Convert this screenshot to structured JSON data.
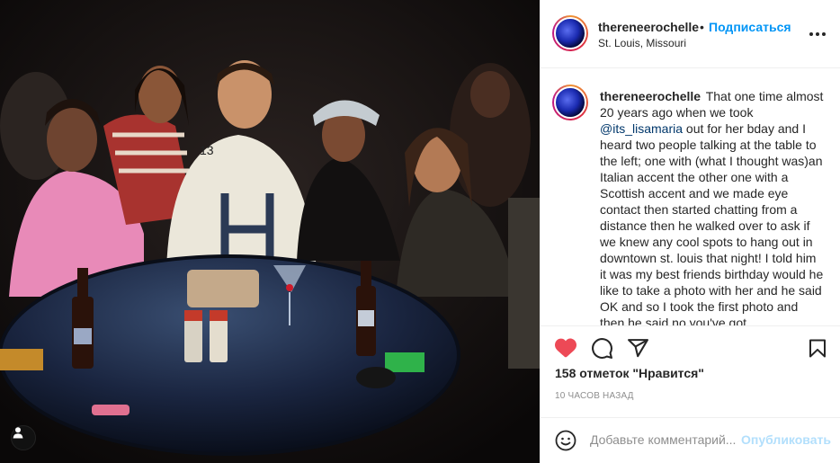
{
  "post": {
    "username": "thereneerochelle",
    "follow_label": "Подписаться",
    "separator": "•",
    "location": "St. Louis, Missouri",
    "caption_author": "thereneerochelle",
    "caption_before_mention": "That one time almost 20 years ago when we took ",
    "mention": "@its_lisamaria",
    "caption_after_mention": " out for her bday and I heard two people talking at the table to the left; one with (what I thought was)an Italian accent the other one with a Scottish accent and we made eye contact then started chatting from a distance then he walked over to ask if we knew any cool spots to hang out in downtown st. louis that night! I told him it was my best friends birthday would he like to take a photo with her and he said OK and so I took the first photo and then he said no you've got",
    "likes": "158 отметок \"Нравится\"",
    "timestamp": "10 ЧАСОВ НАЗАД",
    "liked": true
  },
  "comment_box": {
    "placeholder": "Добавьте комментарий...",
    "post_label": "Опубликовать"
  },
  "icons": {
    "like": "heart-icon",
    "comment": "comment-icon",
    "share": "share-icon",
    "save": "bookmark-icon",
    "emoji": "emoji-icon",
    "more": "more-options-icon",
    "user_tags": "user-tag-icon"
  },
  "colors": {
    "accent_blue": "#0095f6",
    "like_red": "#ed4956",
    "muted": "#8e8e8e",
    "post_disabled": "#b2dffc"
  }
}
